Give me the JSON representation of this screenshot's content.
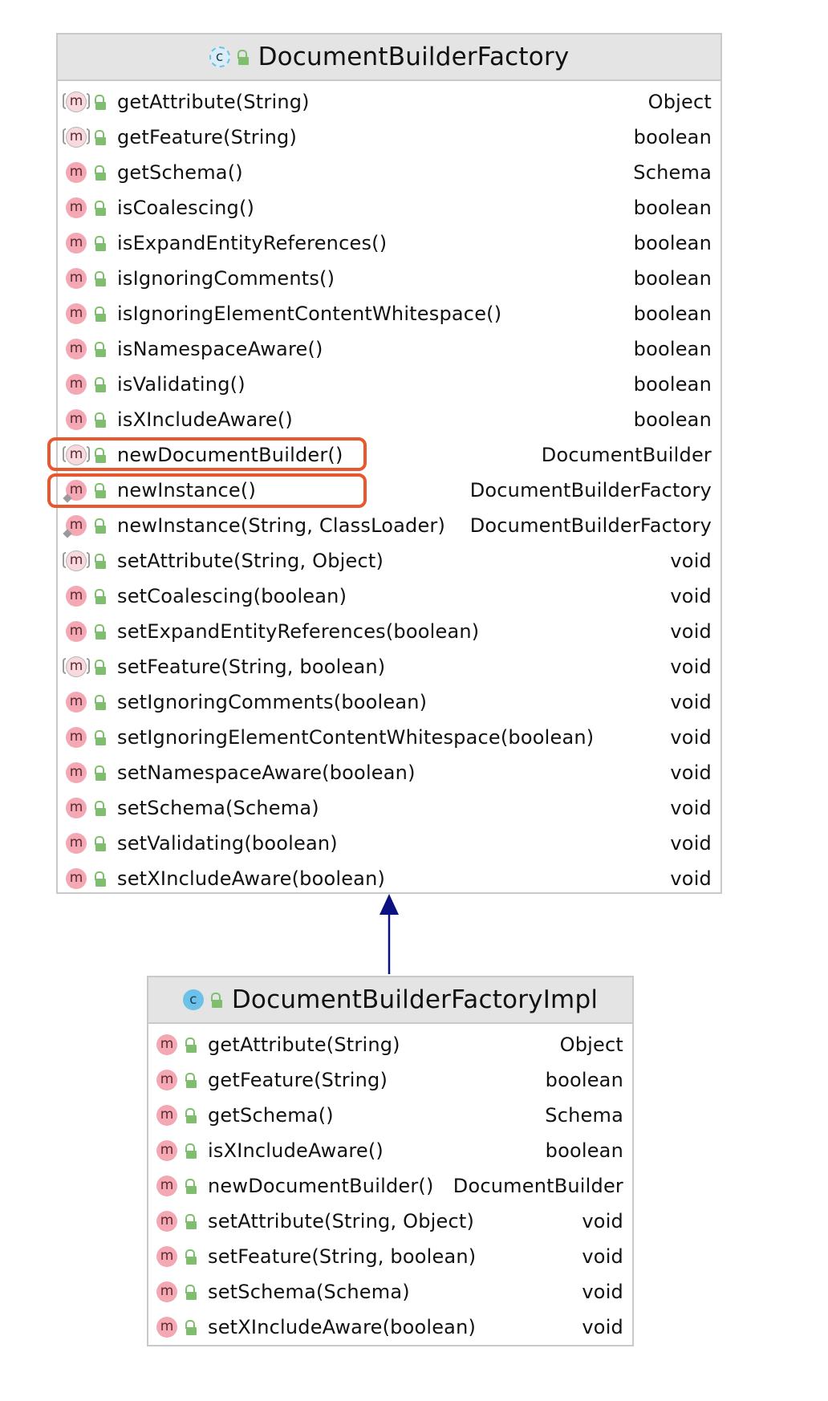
{
  "classes": [
    {
      "name": "DocumentBuilderFactory",
      "icon": "abstract-class-icon",
      "methods": [
        {
          "name": "getAttribute(String)",
          "type": "Object",
          "icon": "abstract-method-icon"
        },
        {
          "name": "getFeature(String)",
          "type": "boolean",
          "icon": "abstract-method-icon"
        },
        {
          "name": "getSchema()",
          "type": "Schema",
          "icon": "method-icon"
        },
        {
          "name": "isCoalescing()",
          "type": "boolean",
          "icon": "method-icon"
        },
        {
          "name": "isExpandEntityReferences()",
          "type": "boolean",
          "icon": "method-icon"
        },
        {
          "name": "isIgnoringComments()",
          "type": "boolean",
          "icon": "method-icon"
        },
        {
          "name": "isIgnoringElementContentWhitespace()",
          "type": "boolean",
          "icon": "method-icon"
        },
        {
          "name": "isNamespaceAware()",
          "type": "boolean",
          "icon": "method-icon"
        },
        {
          "name": "isValidating()",
          "type": "boolean",
          "icon": "method-icon"
        },
        {
          "name": "isXIncludeAware()",
          "type": "boolean",
          "icon": "method-icon"
        },
        {
          "name": "newDocumentBuilder()",
          "type": "DocumentBuilder",
          "icon": "abstract-method-icon"
        },
        {
          "name": "newInstance()",
          "type": "DocumentBuilderFactory",
          "icon": "static-method-icon"
        },
        {
          "name": "newInstance(String, ClassLoader)",
          "type": "DocumentBuilderFactory",
          "icon": "static-method-icon"
        },
        {
          "name": "setAttribute(String, Object)",
          "type": "void",
          "icon": "abstract-method-icon"
        },
        {
          "name": "setCoalescing(boolean)",
          "type": "void",
          "icon": "method-icon"
        },
        {
          "name": "setExpandEntityReferences(boolean)",
          "type": "void",
          "icon": "method-icon"
        },
        {
          "name": "setFeature(String, boolean)",
          "type": "void",
          "icon": "abstract-method-icon"
        },
        {
          "name": "setIgnoringComments(boolean)",
          "type": "void",
          "icon": "method-icon"
        },
        {
          "name": "setIgnoringElementContentWhitespace(boolean)",
          "type": "void",
          "icon": "method-icon"
        },
        {
          "name": "setNamespaceAware(boolean)",
          "type": "void",
          "icon": "method-icon"
        },
        {
          "name": "setSchema(Schema)",
          "type": "void",
          "icon": "method-icon"
        },
        {
          "name": "setValidating(boolean)",
          "type": "void",
          "icon": "method-icon"
        },
        {
          "name": "setXIncludeAware(boolean)",
          "type": "void",
          "icon": "method-icon"
        }
      ]
    },
    {
      "name": "DocumentBuilderFactoryImpl",
      "icon": "class-icon",
      "methods": [
        {
          "name": "getAttribute(String)",
          "type": "Object",
          "icon": "method-icon"
        },
        {
          "name": "getFeature(String)",
          "type": "boolean",
          "icon": "method-icon"
        },
        {
          "name": "getSchema()",
          "type": "Schema",
          "icon": "method-icon"
        },
        {
          "name": "isXIncludeAware()",
          "type": "boolean",
          "icon": "method-icon"
        },
        {
          "name": "newDocumentBuilder()",
          "type": "DocumentBuilder",
          "icon": "method-icon"
        },
        {
          "name": "setAttribute(String, Object)",
          "type": "void",
          "icon": "method-icon"
        },
        {
          "name": "setFeature(String, boolean)",
          "type": "void",
          "icon": "method-icon"
        },
        {
          "name": "setSchema(Schema)",
          "type": "void",
          "icon": "method-icon"
        },
        {
          "name": "setXIncludeAware(boolean)",
          "type": "void",
          "icon": "method-icon"
        }
      ]
    }
  ],
  "icons": {
    "class_letter": "c",
    "method_letter": "m"
  },
  "colors": {
    "highlight": "#e8582f",
    "arrow": "#0b1180",
    "method_icon": "#f4a8b4",
    "class_icon": "#6cc1e8",
    "lock_icon": "#7fbe6e"
  },
  "highlighted_methods": [
    "newDocumentBuilder()",
    "newInstance()"
  ]
}
